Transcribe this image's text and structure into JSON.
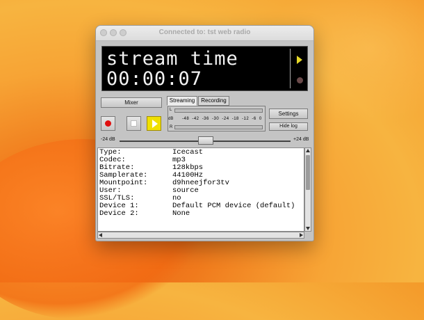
{
  "window": {
    "title": "Connected to: tst web radio"
  },
  "display": {
    "line1": "stream time",
    "line2": "00:00:07",
    "accent": "#e6d828"
  },
  "controls": {
    "mixer_label": "Mixer",
    "record_icon": "record-icon",
    "stop_icon": "stop-icon",
    "play_icon": "play-icon",
    "settings_label": "Settings",
    "hide_log_label": "Hide log"
  },
  "tabs": [
    {
      "label": "Streaming",
      "active": true
    },
    {
      "label": "Recording",
      "active": false
    }
  ],
  "vu_meter": {
    "left_label": "L",
    "db_label": "dB",
    "right_label": "R",
    "scale": [
      "-48",
      "-42",
      "-36",
      "-30",
      "-24",
      "-18",
      "-12",
      "-6",
      "0"
    ]
  },
  "volume": {
    "min_label": "-24 dB",
    "max_label": "+24 dB",
    "level_fraction": 0.5
  },
  "log": {
    "rows": [
      {
        "key": "Type:",
        "value": "Icecast"
      },
      {
        "key": "Codec:",
        "value": "mp3"
      },
      {
        "key": "Bitrate:",
        "value": "128kbps"
      },
      {
        "key": "Samplerate:",
        "value": "44100Hz"
      },
      {
        "key": "Mountpoint:",
        "value": "d9hneejfor3tv"
      },
      {
        "key": "User:",
        "value": "source"
      },
      {
        "key": "SSL/TLS:",
        "value": "no"
      },
      {
        "key": "Device 1:",
        "value": "Default PCM device (default)"
      },
      {
        "key": "Device 2:",
        "value": "None"
      }
    ]
  }
}
